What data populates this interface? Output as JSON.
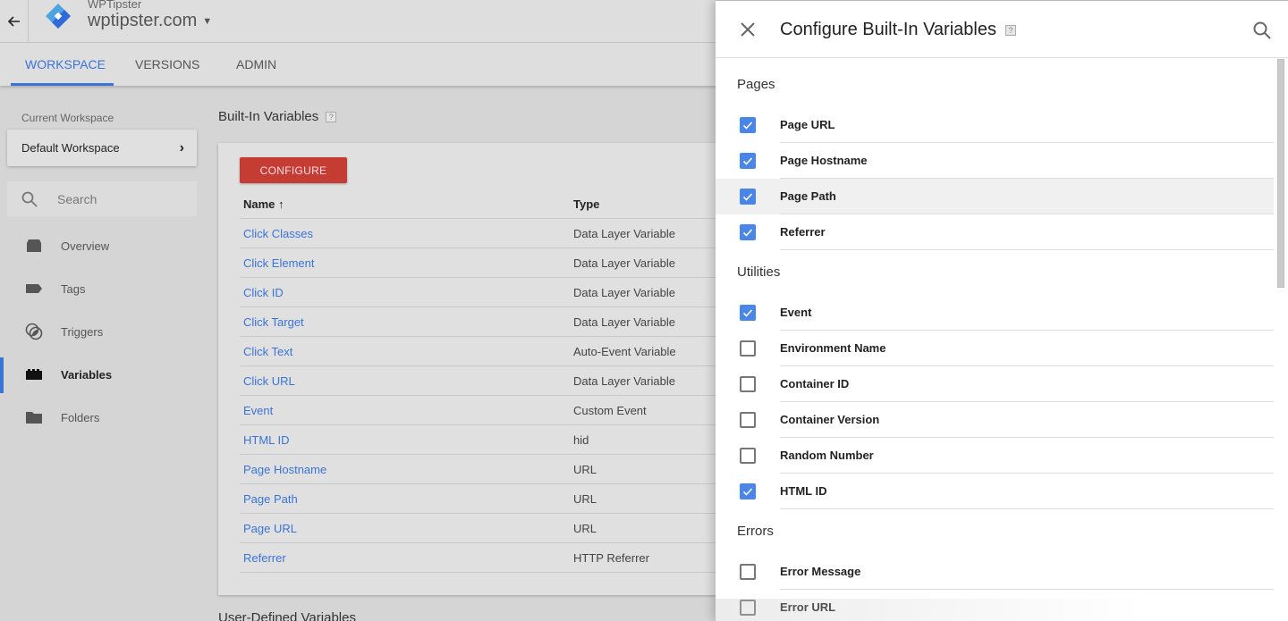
{
  "header": {
    "account_name": "WPTipster",
    "container_name": "wptipster.com",
    "back_icon": "arrow-left-icon",
    "logo": "gtm-logo-icon"
  },
  "tabs": [
    {
      "label": "WORKSPACE",
      "active": true
    },
    {
      "label": "VERSIONS",
      "active": false
    },
    {
      "label": "ADMIN",
      "active": false
    }
  ],
  "sidebar": {
    "workspace_label": "Current Workspace",
    "workspace_name": "Default Workspace",
    "search_placeholder": "Search",
    "items": [
      {
        "label": "Overview",
        "icon": "overview-icon",
        "active": false
      },
      {
        "label": "Tags",
        "icon": "tag-icon",
        "active": false
      },
      {
        "label": "Triggers",
        "icon": "trigger-icon",
        "active": false
      },
      {
        "label": "Variables",
        "icon": "variables-icon",
        "active": true
      },
      {
        "label": "Folders",
        "icon": "folder-icon",
        "active": false
      }
    ]
  },
  "main": {
    "builtin_title": "Built-In Variables",
    "help": "?",
    "configure_label": "CONFIGURE",
    "columns": {
      "name": "Name ↑",
      "type": "Type"
    },
    "rows": [
      {
        "name": "Click Classes",
        "type": "Data Layer Variable"
      },
      {
        "name": "Click Element",
        "type": "Data Layer Variable"
      },
      {
        "name": "Click ID",
        "type": "Data Layer Variable"
      },
      {
        "name": "Click Target",
        "type": "Data Layer Variable"
      },
      {
        "name": "Click Text",
        "type": "Auto-Event Variable"
      },
      {
        "name": "Click URL",
        "type": "Data Layer Variable"
      },
      {
        "name": "Event",
        "type": "Custom Event"
      },
      {
        "name": "HTML ID",
        "type": "hid"
      },
      {
        "name": "Page Hostname",
        "type": "URL"
      },
      {
        "name": "Page Path",
        "type": "URL"
      },
      {
        "name": "Page URL",
        "type": "URL"
      },
      {
        "name": "Referrer",
        "type": "HTTP Referrer"
      }
    ],
    "user_defined_title": "User-Defined Variables"
  },
  "panel": {
    "title": "Configure Built-In Variables",
    "help": "?",
    "sections": [
      {
        "title": "Pages",
        "items": [
          {
            "label": "Page URL",
            "checked": true
          },
          {
            "label": "Page Hostname",
            "checked": true
          },
          {
            "label": "Page Path",
            "checked": true,
            "hover": true
          },
          {
            "label": "Referrer",
            "checked": true
          }
        ]
      },
      {
        "title": "Utilities",
        "items": [
          {
            "label": "Event",
            "checked": true
          },
          {
            "label": "Environment Name",
            "checked": false
          },
          {
            "label": "Container ID",
            "checked": false
          },
          {
            "label": "Container Version",
            "checked": false
          },
          {
            "label": "Random Number",
            "checked": false
          },
          {
            "label": "HTML ID",
            "checked": true
          }
        ]
      },
      {
        "title": "Errors",
        "items": [
          {
            "label": "Error Message",
            "checked": false
          },
          {
            "label": "Error URL",
            "checked": false
          }
        ]
      }
    ]
  },
  "colors": {
    "accent": "#3a74d6",
    "checkbox": "#4a86e8",
    "configure_button": "#c43c32"
  }
}
